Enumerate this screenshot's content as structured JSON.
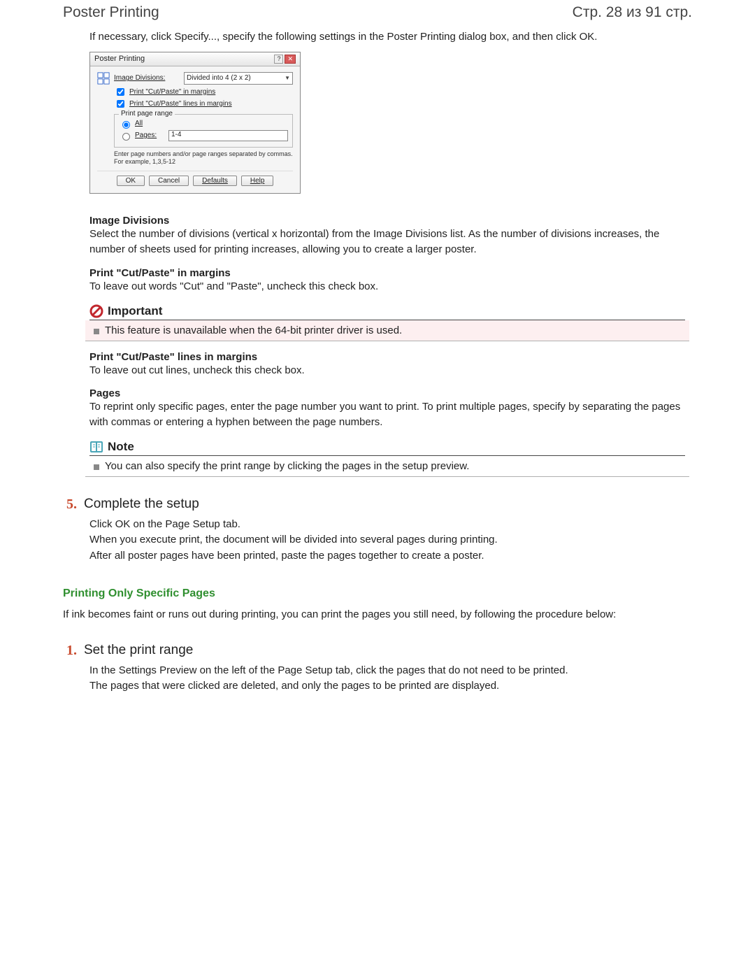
{
  "header": {
    "title": "Poster Printing",
    "pager": "Стр. 28 из 91 стр."
  },
  "intro": "If necessary, click Specify..., specify the following settings in the Poster Printing dialog box, and then click OK.",
  "dialog": {
    "title": "Poster Printing",
    "divisions_label": "Image Divisions:",
    "divisions_value": "Divided into 4 (2 x 2)",
    "cb1": "Print \"Cut/Paste\" in margins",
    "cb2": "Print \"Cut/Paste\" lines in margins",
    "group_title": "Print page range",
    "radio_all": "All",
    "radio_pages": "Pages:",
    "pages_value": "1-4",
    "hint": "Enter page numbers and/or page ranges separated by commas. For example, 1,3,5-12",
    "btn_ok": "OK",
    "btn_cancel": "Cancel",
    "btn_defaults": "Defaults",
    "btn_help": "Help"
  },
  "opts": {
    "img_div_t": "Image Divisions",
    "img_div_b": "Select the number of divisions (vertical x horizontal) from the Image Divisions list. As the number of divisions increases, the number of sheets used for printing increases, allowing you to create a larger poster.",
    "cp_margin_t": "Print \"Cut/Paste\" in margins",
    "cp_margin_b": "To leave out words \"Cut\" and \"Paste\", uncheck this check box.",
    "important_title": "Important",
    "important_text": "This feature is unavailable when the 64-bit printer driver is used.",
    "cpl_t": "Print \"Cut/Paste\" lines in margins",
    "cpl_b": "To leave out cut lines, uncheck this check box.",
    "pages_t": "Pages",
    "pages_b": "To reprint only specific pages, enter the page number you want to print. To print multiple pages, specify by separating the pages with commas or entering a hyphen between the page numbers.",
    "note_title": "Note",
    "note_text": "You can also specify the print range by clicking the pages in the setup preview."
  },
  "step5": {
    "num": "5.",
    "title": "Complete the setup",
    "l1": "Click OK on the Page Setup tab.",
    "l2": "When you execute print, the document will be divided into several pages during printing.",
    "l3": "After all poster pages have been printed, paste the pages together to create a poster."
  },
  "section2": {
    "heading": "Printing Only Specific Pages",
    "intro": "If ink becomes faint or runs out during printing, you can print the pages you still need, by following the procedure below:"
  },
  "step1": {
    "num": "1.",
    "title": "Set the print range",
    "l1": "In the Settings Preview on the left of the Page Setup tab, click the pages that do not need to be printed.",
    "l2": "The pages that were clicked are deleted, and only the pages to be printed are displayed."
  }
}
